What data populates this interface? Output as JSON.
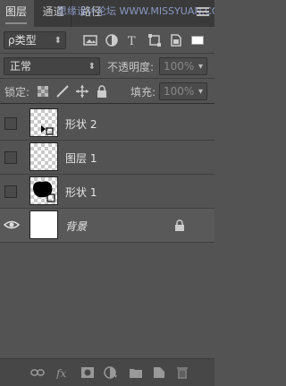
{
  "tabs": [
    {
      "label": "图层"
    },
    {
      "label": "通道"
    },
    {
      "label": "路径"
    }
  ],
  "watermark": "思缘设计论坛 WWW.MISSYUAN.COM",
  "filter": {
    "kind_label": "ρ类型"
  },
  "blend": {
    "mode": "正常",
    "opacity_label": "不透明度:",
    "opacity_value": "100%"
  },
  "lock": {
    "label": "锁定:",
    "fill_label": "填充:",
    "fill_value": "100%"
  },
  "layers": [
    {
      "name": "形状 2",
      "visible": false,
      "type": "shape-triangle"
    },
    {
      "name": "图层 1",
      "visible": false,
      "type": "empty"
    },
    {
      "name": "形状 1",
      "visible": false,
      "type": "shape-blob"
    },
    {
      "name": "背景",
      "visible": true,
      "type": "background",
      "locked": true
    }
  ]
}
